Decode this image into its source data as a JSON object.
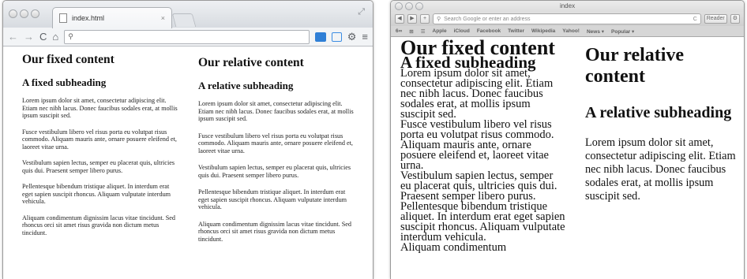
{
  "chrome": {
    "tab": {
      "title": "index.html",
      "close": "×"
    },
    "toolbar": {
      "back": "←",
      "forward": "→",
      "reload": "C",
      "home": "⌂",
      "search": "⚲"
    },
    "content": {
      "fixed": {
        "heading": "Our fixed content",
        "subheading": "A fixed subheading",
        "paragraphs": [
          "Lorem ipsum dolor sit amet, consectetur adipiscing elit. Etiam nec nibh lacus. Donec faucibus sodales erat, at mollis ipsum suscipit sed.",
          "Fusce vestibulum libero vel risus porta eu volutpat risus commodo. Aliquam mauris ante, ornare posuere eleifend et, laoreet vitae urna.",
          "Vestibulum sapien lectus, semper eu placerat quis, ultricies quis dui. Praesent semper libero purus.",
          "Pellentesque bibendum tristique aliquet. In interdum erat eget sapien suscipit rhoncus. Aliquam vulputate interdum vehicula.",
          "Aliquam condimentum dignissim lacus vitae tincidunt. Sed rhoncus orci sit amet risus gravida non dictum metus tincidunt."
        ]
      },
      "relative": {
        "heading": "Our relative content",
        "subheading": "A relative subheading",
        "paragraphs": [
          "Lorem ipsum dolor sit amet, consectetur adipiscing elit. Etiam nec nibh lacus. Donec faucibus sodales erat, at mollis ipsum suscipit sed.",
          "Fusce vestibulum libero vel risus porta eu volutpat risus commodo. Aliquam mauris ante, ornare posuere eleifend et, laoreet vitae urna.",
          "Vestibulum sapien lectus, semper eu placerat quis, ultricies quis dui. Praesent semper libero purus.",
          "Pellentesque bibendum tristique aliquet. In interdum erat eget sapien suscipit rhoncus. Aliquam vulputate interdum vehicula.",
          "Aliquam condimentum dignissim lacus vitae tincidunt. Sed rhoncus orci sit amet risus gravida non dictum metus tincidunt."
        ]
      }
    }
  },
  "safari": {
    "window_title": "index",
    "toolbar": {
      "back": "◀",
      "forward": "▶",
      "add": "+",
      "address_placeholder": "Search Google or enter an address",
      "reload": "C",
      "reader": "Reader"
    },
    "bookmarks": [
      "Apple",
      "iCloud",
      "Facebook",
      "Twitter",
      "Wikipedia",
      "Yahoo!",
      "News ▾",
      "Popular ▾"
    ],
    "content": {
      "fixed": {
        "heading": "Our fixed content",
        "subheading": "A fixed subheading",
        "paragraphs": [
          "Lorem ipsum dolor sit amet, consectetur adipiscing elit. Etiam nec nibh lacus. Donec faucibus sodales erat, at mollis ipsum suscipit sed.",
          "Fusce vestibulum libero vel risus porta eu volutpat risus commodo. Aliquam mauris ante, ornare posuere eleifend et, laoreet vitae urna.",
          "Vestibulum sapien lectus, semper eu placerat quis, ultricies quis dui. Praesent semper libero purus.",
          "Pellentesque bibendum tristique aliquet. In interdum erat eget sapien suscipit rhoncus. Aliquam vulputate interdum vehicula.",
          "Aliquam condimentum"
        ]
      },
      "relative": {
        "heading": "Our relative content",
        "subheading": "A relative subheading",
        "paragraphs": [
          "Lorem ipsum dolor sit amet, consectetur adipiscing elit. Etiam nec nibh lacus. Donec faucibus sodales erat, at mollis ipsum suscipit sed."
        ]
      }
    }
  }
}
